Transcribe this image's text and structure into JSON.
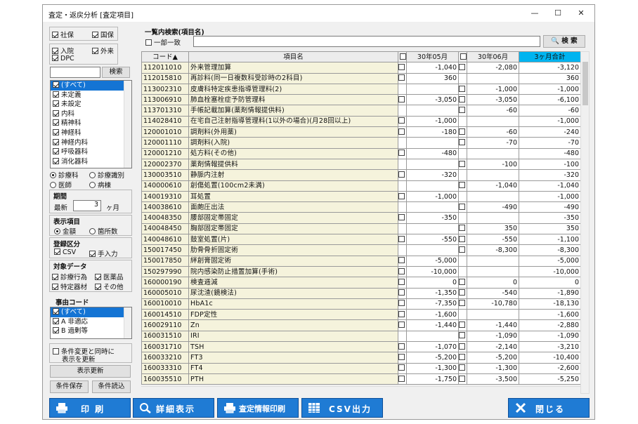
{
  "window": {
    "title": "査定・返戻分析 [査定項目]"
  },
  "left": {
    "insurance": [
      {
        "label": "社保",
        "checked": true
      },
      {
        "label": "国保",
        "checked": true
      }
    ],
    "care": [
      {
        "label": "入院",
        "checked": true
      },
      {
        "label": "外来",
        "checked": true
      },
      {
        "label": "DPC",
        "checked": true
      }
    ],
    "search_value": "",
    "search_button": "検索",
    "dept_items": [
      {
        "label": "(すべて)",
        "checked": true,
        "selected": true
      },
      {
        "label": "未定義",
        "checked": true
      },
      {
        "label": "未設定",
        "checked": true
      },
      {
        "label": "内科",
        "checked": true
      },
      {
        "label": "精神科",
        "checked": true
      },
      {
        "label": "神経科",
        "checked": true
      },
      {
        "label": "神経内科",
        "checked": true
      },
      {
        "label": "呼吸器科",
        "checked": true
      },
      {
        "label": "消化器科",
        "checked": true
      }
    ],
    "radio1": [
      {
        "label": "診療科",
        "on": true
      },
      {
        "label": "診療識別",
        "on": false
      },
      {
        "label": "医師",
        "on": false
      },
      {
        "label": "病棟",
        "on": false
      }
    ],
    "period": {
      "title": "期間",
      "prefix": "最新",
      "value": "3",
      "unit": "ヶ月"
    },
    "display": {
      "title": "表示項目",
      "opts": [
        {
          "label": "金額",
          "on": true
        },
        {
          "label": "箇所数",
          "on": false
        }
      ]
    },
    "register": {
      "title": "登録区分",
      "opts": [
        {
          "label": "CSV",
          "checked": true
        },
        {
          "label": "手入力",
          "checked": true
        }
      ]
    },
    "target": {
      "title": "対象データ",
      "opts": [
        {
          "label": "診療行為",
          "checked": true
        },
        {
          "label": "医薬品",
          "checked": true
        },
        {
          "label": "特定器材",
          "checked": true
        },
        {
          "label": "その他",
          "checked": true
        }
      ]
    },
    "reason": {
      "title": "事由コード",
      "items": [
        {
          "label": "(すべて)",
          "checked": true,
          "selected": true
        },
        {
          "label": "A 非適応",
          "checked": true
        },
        {
          "label": "B 過剰等",
          "checked": true
        }
      ]
    },
    "auto_update": {
      "label1": "条件変更と同時に",
      "label2": "表示を更新",
      "checked": false
    },
    "refresh_button": "表示更新",
    "save_button": "条件保存",
    "load_button": "条件読込"
  },
  "search": {
    "title": "一覧内検索(項目名)",
    "partial": {
      "label": "一部一致",
      "checked": false
    },
    "value": "",
    "button": "検 索"
  },
  "table": {
    "headers": {
      "code": "コード▲",
      "name": "項目名",
      "m1": "30年05月",
      "m2": "30年06月",
      "total": "3ヶ月合計"
    },
    "rows": [
      {
        "code": "112011010",
        "name": "外来管理加算",
        "c1": true,
        "m1": "-1,040",
        "c2": true,
        "m2": "-2,080",
        "total": "-3,120"
      },
      {
        "code": "112015810",
        "name": "再診料(同一日複数科受診時の2科目)",
        "c1": true,
        "m1": "360",
        "c2": false,
        "m2": "",
        "total": "360"
      },
      {
        "code": "113002310",
        "name": "皮膚科特定疾患指導管理料(2)",
        "c1": false,
        "m1": "",
        "c2": true,
        "m2": "-1,000",
        "total": "-1,000"
      },
      {
        "code": "113006910",
        "name": "肺血栓塞栓症予防管理料",
        "c1": true,
        "m1": "-3,050",
        "c2": true,
        "m2": "-3,050",
        "total": "-6,100"
      },
      {
        "code": "113701310",
        "name": "手帳記載加算(薬剤情報提供料)",
        "c1": false,
        "m1": "",
        "c2": true,
        "m2": "-60",
        "total": "-60"
      },
      {
        "code": "114028410",
        "name": "在宅自己注射指導管理料(1以外の場合)(月28回以上)",
        "c1": true,
        "m1": "-1,000",
        "c2": false,
        "m2": "",
        "total": "-1,000"
      },
      {
        "code": "120001010",
        "name": "調剤料(外用薬)",
        "c1": true,
        "m1": "-180",
        "c2": true,
        "m2": "-60",
        "total": "-240"
      },
      {
        "code": "120001110",
        "name": "調剤料(入院)",
        "c1": false,
        "m1": "",
        "c2": true,
        "m2": "-70",
        "total": "-70"
      },
      {
        "code": "120001210",
        "name": "処方料(その他)",
        "c1": true,
        "m1": "-480",
        "c2": false,
        "m2": "",
        "total": "-480"
      },
      {
        "code": "120002370",
        "name": "薬剤情報提供料",
        "c1": false,
        "m1": "",
        "c2": true,
        "m2": "-100",
        "total": "-100"
      },
      {
        "code": "130003510",
        "name": "静脈内注射",
        "c1": true,
        "m1": "-320",
        "c2": false,
        "m2": "",
        "total": "-320"
      },
      {
        "code": "140000610",
        "name": "創傷処置(100cm2未満)",
        "c1": false,
        "m1": "",
        "c2": true,
        "m2": "-1,040",
        "total": "-1,040"
      },
      {
        "code": "140019310",
        "name": "耳処置",
        "c1": true,
        "m1": "-1,000",
        "c2": false,
        "m2": "",
        "total": "-1,000"
      },
      {
        "code": "140038610",
        "name": "面皰圧出法",
        "c1": false,
        "m1": "",
        "c2": true,
        "m2": "-490",
        "total": "-490"
      },
      {
        "code": "140048350",
        "name": "腰部固定帯固定",
        "c1": true,
        "m1": "-350",
        "c2": false,
        "m2": "",
        "total": "-350"
      },
      {
        "code": "140048450",
        "name": "胸部固定帯固定",
        "c1": false,
        "m1": "",
        "c2": true,
        "m2": "350",
        "total": "350"
      },
      {
        "code": "140048610",
        "name": "鼓室処置(片)",
        "c1": true,
        "m1": "-550",
        "c2": true,
        "m2": "-550",
        "total": "-1,100"
      },
      {
        "code": "150017450",
        "name": "肋骨骨折固定術",
        "c1": false,
        "m1": "",
        "c2": true,
        "m2": "-8,300",
        "total": "-8,300"
      },
      {
        "code": "150017850",
        "name": "絆創膏固定術",
        "c1": true,
        "m1": "-5,000",
        "c2": false,
        "m2": "",
        "total": "-5,000"
      },
      {
        "code": "150297990",
        "name": "院内感染防止措置加算(手術)",
        "c1": true,
        "m1": "-10,000",
        "c2": false,
        "m2": "",
        "total": "-10,000"
      },
      {
        "code": "160000190",
        "name": "検査逓減",
        "c1": true,
        "m1": "0",
        "c2": true,
        "m2": "0",
        "total": "0"
      },
      {
        "code": "160005010",
        "name": "尿沈渣(鏡検法)",
        "c1": true,
        "m1": "-1,350",
        "c2": true,
        "m2": "-540",
        "total": "-1,890"
      },
      {
        "code": "160010010",
        "name": "HbA1c",
        "c1": true,
        "m1": "-7,350",
        "c2": true,
        "m2": "-10,780",
        "total": "-18,130"
      },
      {
        "code": "160014510",
        "name": "FDP定性",
        "c1": true,
        "m1": "-1,600",
        "c2": false,
        "m2": "",
        "total": "-1,600"
      },
      {
        "code": "160029110",
        "name": "Zn",
        "c1": true,
        "m1": "-1,440",
        "c2": true,
        "m2": "-1,440",
        "total": "-2,880"
      },
      {
        "code": "160031510",
        "name": "IRI",
        "c1": false,
        "m1": "",
        "c2": true,
        "m2": "-1,090",
        "total": "-1,090"
      },
      {
        "code": "160031710",
        "name": "TSH",
        "c1": true,
        "m1": "-1,070",
        "c2": true,
        "m2": "-2,140",
        "total": "-3,210"
      },
      {
        "code": "160033210",
        "name": "FT3",
        "c1": true,
        "m1": "-5,200",
        "c2": true,
        "m2": "-5,200",
        "total": "-10,400"
      },
      {
        "code": "160033310",
        "name": "FT4",
        "c1": true,
        "m1": "-1,300",
        "c2": true,
        "m2": "-1,300",
        "total": "-2,600"
      },
      {
        "code": "160035510",
        "name": "PTH",
        "c1": true,
        "m1": "-1,750",
        "c2": true,
        "m2": "-3,500",
        "total": "-5,250"
      }
    ]
  },
  "footer": {
    "print": "印 刷",
    "detail": "詳細表示",
    "assess_print": "査定情報印刷",
    "csv": "CSV出力",
    "close": "閉じる"
  }
}
